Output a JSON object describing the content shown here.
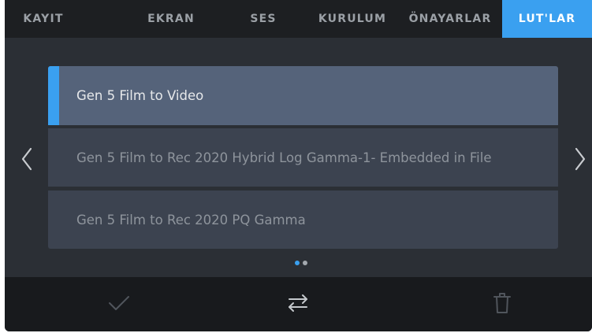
{
  "tabs": [
    {
      "label": "KAYIT"
    },
    {
      "label": "EKRAN"
    },
    {
      "label": "SES"
    },
    {
      "label": "KURULUM"
    },
    {
      "label": "ÖNAYARLAR"
    },
    {
      "label": "LUT'LAR"
    }
  ],
  "active_tab": "LUT'LAR",
  "lut_list": [
    {
      "name": "Gen 5 Film to Video",
      "selected": true
    },
    {
      "name": "Gen 5 Film to Rec 2020 Hybrid Log Gamma-1- Embedded in File",
      "selected": false
    },
    {
      "name": "Gen 5 Film to Rec 2020 PQ Gamma",
      "selected": false
    }
  ],
  "pagination": {
    "pages": 2,
    "current": 1
  },
  "nav_icons": {
    "left": "chevron-left-icon",
    "right": "chevron-right-icon"
  },
  "bottom_actions": [
    {
      "icon": "checkmark-icon"
    },
    {
      "icon": "swap-arrows-icon"
    },
    {
      "icon": "trash-icon"
    }
  ],
  "colors": {
    "accent": "#3aa0f0",
    "background": "#2b2f35",
    "tabbar": "#1d1f22",
    "row_selected": "#55637a",
    "row": "#3c4350"
  }
}
